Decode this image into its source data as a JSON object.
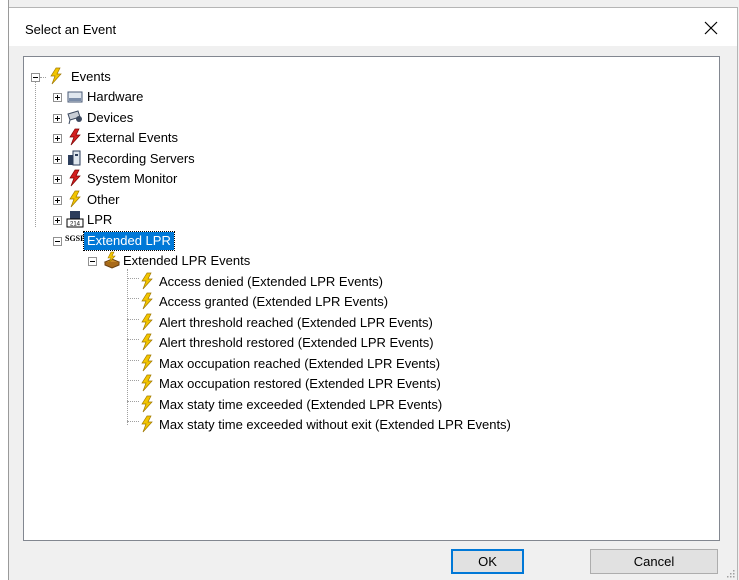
{
  "dialog": {
    "title": "Select an Event",
    "close_glyph": "✕"
  },
  "tree": {
    "root": "Events",
    "categories": [
      "Hardware",
      "Devices",
      "External Events",
      "Recording Servers",
      "System Monitor",
      "Other",
      "LPR"
    ],
    "selected_badge": "SGSE",
    "selected": "Extended LPR",
    "group": "Extended LPR Events",
    "events": [
      "Access denied (Extended LPR Events)",
      "Access granted (Extended LPR Events)",
      "Alert threshold reached (Extended LPR Events)",
      "Alert threshold restored (Extended LPR Events)",
      "Max occupation reached (Extended LPR Events)",
      "Max occupation restored (Extended LPR Events)",
      "Max staty time exceeded (Extended LPR Events)",
      "Max staty time exceeded without exit (Extended LPR Events)"
    ],
    "lpr_plate_text": "214"
  },
  "buttons": {
    "ok": "OK",
    "cancel": "Cancel"
  },
  "icons": {
    "events": "lightning-icon",
    "hardware": "hardware-box-icon",
    "devices": "camera-icon",
    "external": "red-lightning-icon",
    "recording": "server-icon",
    "monitor": "red-lightning-icon",
    "other": "lightning-icon",
    "lpr": "license-plate-icon"
  },
  "colors": {
    "selection": "#0078d7",
    "bolt": "#f2c500",
    "bolt_red": "#d42020"
  }
}
